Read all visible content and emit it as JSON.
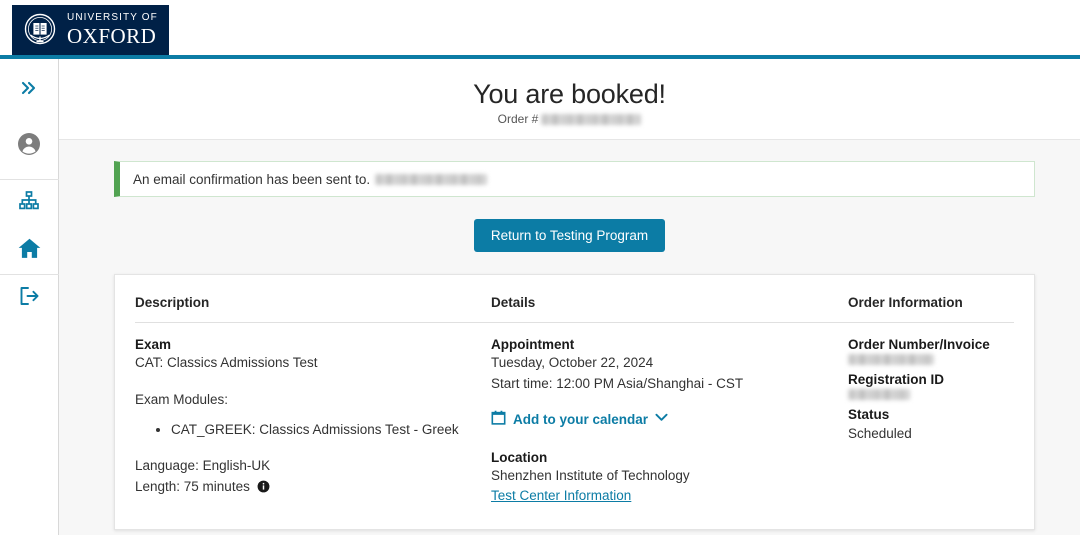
{
  "header": {
    "university_line1": "UNIVERSITY OF",
    "university_line2": "OXFORD",
    "crest_icon": "oxford-crest-icon",
    "accent_color": "#0c7ca5",
    "brand_color": "#002147"
  },
  "sidebar": {
    "items": [
      {
        "name": "expand-sidebar",
        "icon": "double-chevron-right-icon"
      },
      {
        "name": "account",
        "icon": "user-avatar-icon"
      },
      {
        "name": "organization",
        "icon": "sitemap-icon"
      },
      {
        "name": "home",
        "icon": "home-icon"
      },
      {
        "name": "sign-out",
        "icon": "logout-icon"
      }
    ]
  },
  "main": {
    "title": "You are booked!",
    "order_prefix": "Order #",
    "order_number_redacted": true,
    "alert": {
      "text": "An email confirmation has been sent to.",
      "email_redacted": true,
      "status_color": "#52a352"
    },
    "primary_button": "Return to Testing Program"
  },
  "card": {
    "columns": [
      "Description",
      "Details",
      "Order Information"
    ],
    "description": {
      "exam_label": "Exam",
      "exam_name": "CAT: Classics Admissions Test",
      "modules_label": "Exam Modules:",
      "modules": [
        "CAT_GREEK: Classics Admissions Test - Greek"
      ],
      "language": "Language: English-UK",
      "length": "Length: 75 minutes",
      "length_info_icon": "info-circle-icon"
    },
    "details": {
      "appointment_label": "Appointment",
      "appointment_date": "Tuesday, October 22, 2024",
      "appointment_time": "Start time: 12:00 PM Asia/Shanghai - CST",
      "calendar_link": "Add to your calendar",
      "calendar_icon": "calendar-icon",
      "calendar_chevron": "chevron-down-icon",
      "location_label": "Location",
      "location_name": "Shenzhen Institute of Technology",
      "test_center_link": "Test Center Information"
    },
    "order_information": {
      "order_number_label": "Order Number/Invoice",
      "order_number_redacted": true,
      "registration_id_label": "Registration ID",
      "registration_id_redacted": true,
      "status_label": "Status",
      "status_value": "Scheduled"
    }
  }
}
